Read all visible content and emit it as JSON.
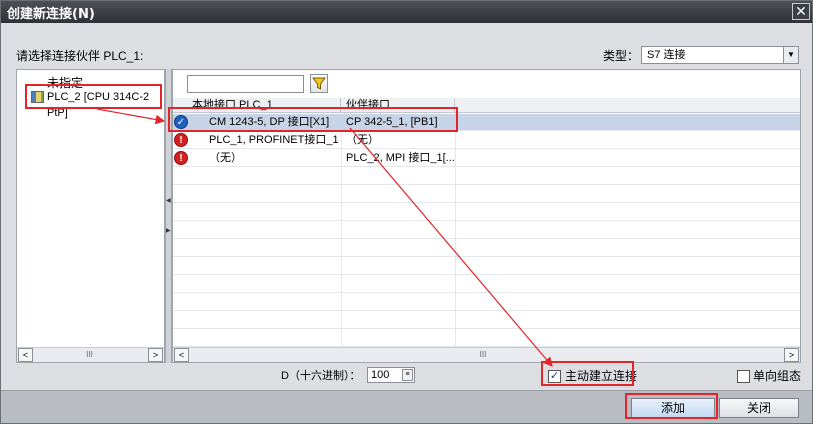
{
  "window": {
    "title": "创建新连接(N)",
    "close_glyph": "✕"
  },
  "prompt": "请选择连接伙伴 PLC_1:",
  "type": {
    "label": "类型：",
    "value": "S7 连接"
  },
  "tree": {
    "items": [
      {
        "label": "未指定"
      },
      {
        "label": "PLC_2 [CPU 314C-2 PtP]"
      }
    ]
  },
  "grid": {
    "columns": [
      "本地接口 PLC_1",
      "伙伴接口"
    ],
    "rows": [
      {
        "status": "ok",
        "local": "CM 1243-5, DP 接口[X1]",
        "partner": "CP 342-5_1, [PB1]"
      },
      {
        "status": "error",
        "local": "PLC_1, PROFINET接口_1...",
        "partner": "（无）"
      },
      {
        "status": "error",
        "local": "（无）",
        "partner": "PLC_2, MPI 接口_1[..."
      }
    ]
  },
  "hex": {
    "label": "D（十六进制）：",
    "value": "100"
  },
  "options": {
    "active_connect": {
      "label": "主动建立连接",
      "checked": true
    },
    "one_way": {
      "label": "单向组态",
      "checked": false
    }
  },
  "buttons": {
    "add": "添加",
    "close": "关闭"
  },
  "scrollbar_thumb": "III",
  "colors": {
    "highlight": "#e0262a",
    "selected_row": "#c7d3e6",
    "title_bar": "#3a3d44"
  }
}
